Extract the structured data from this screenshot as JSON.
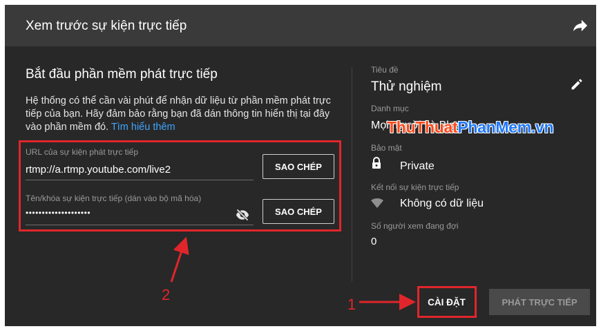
{
  "header": {
    "title": "Xem trước sự kiện trực tiếp",
    "share_icon": "share-arrow-icon"
  },
  "left": {
    "title": "Bắt đầu phần mềm phát trực tiếp",
    "description": "Hệ thống có thể cần vài phút để nhận dữ liệu từ phần mềm phát trực tiếp của bạn. Hãy đảm bảo rằng bạn đã dán thông tin hiển thị tại đây vào phần mềm đó.",
    "learn_more": "Tìm hiểu thêm",
    "url_field": {
      "label": "URL của sự kiện phát trực tiếp",
      "value": "rtmp://a.rtmp.youtube.com/live2",
      "copy_label": "SAO CHÉP"
    },
    "key_field": {
      "label": "Tên/khóa sự kiện trực tiếp (dán vào bộ mã hóa)",
      "value": "••••••••••••••••••••",
      "copy_label": "SAO CHÉP",
      "visibility_icon": "eye-off-icon"
    }
  },
  "right": {
    "title_label": "Tiêu đề",
    "title_value": "Thử nghiệm",
    "category_label": "Danh mục",
    "category_value": "Mọi người và Blog",
    "privacy_label": "Bảo mật",
    "privacy_value": "Private",
    "connection_label": "Kết nối sự kiện trực tiếp",
    "connection_value": "Không có dữ liệu",
    "viewers_label": "Số người xem đang đợi",
    "viewers_value": "0"
  },
  "watermark": {
    "part1": "ThuThuat",
    "part2": "PhanMem.vn"
  },
  "footer": {
    "settings_label": "CÀI ĐẶT",
    "go_live_label": "PHÁT TRỰC TIẾP"
  },
  "annotations": {
    "one": "1",
    "two": "2"
  },
  "colors": {
    "annotation_red": "#e0262b",
    "link_blue": "#3ea6ff",
    "dialog_bg": "#282828",
    "header_bg": "#3a3a3a"
  }
}
